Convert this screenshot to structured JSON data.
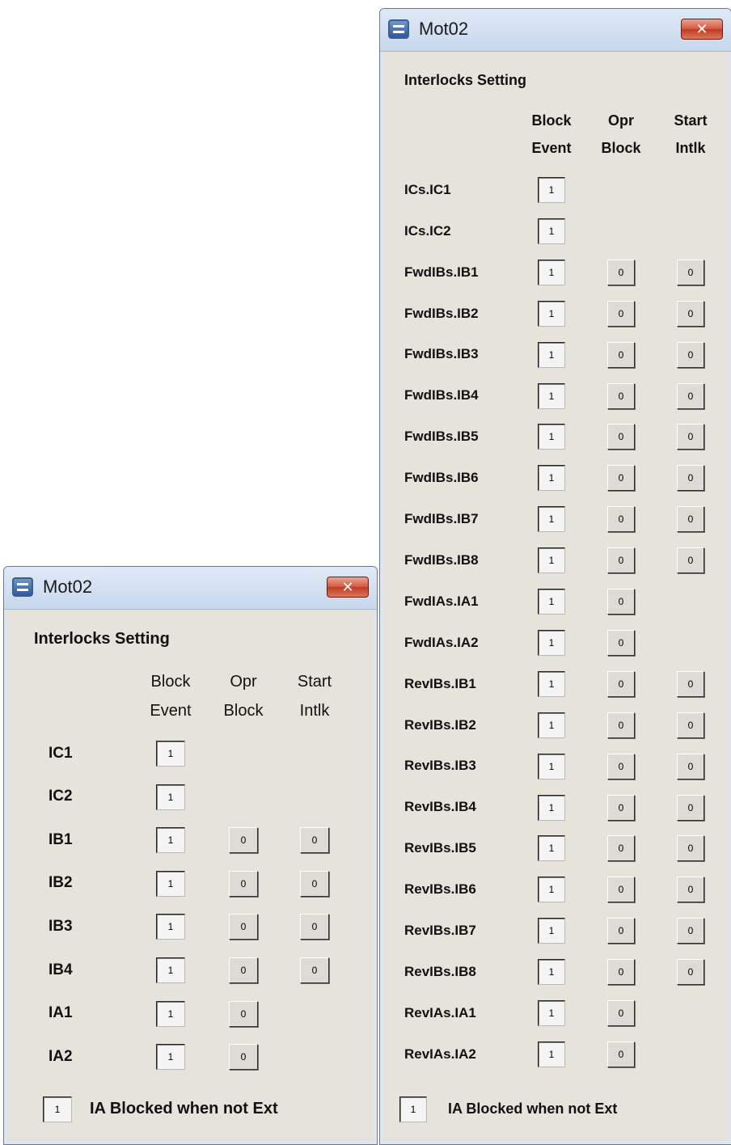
{
  "window_small": {
    "title": "Mot02",
    "close_label": "✕",
    "heading": "Interlocks Setting",
    "col_headers": {
      "block_event": [
        "Block",
        "Event"
      ],
      "opr_block": [
        "Opr",
        "Block"
      ],
      "start_intlk": [
        "Start",
        "Intlk"
      ]
    },
    "rows": [
      {
        "label": "IC1",
        "block_event": "1"
      },
      {
        "label": "IC2",
        "block_event": "1"
      },
      {
        "label": "IB1",
        "block_event": "1",
        "opr_block": "0",
        "start_intlk": "0"
      },
      {
        "label": "IB2",
        "block_event": "1",
        "opr_block": "0",
        "start_intlk": "0"
      },
      {
        "label": "IB3",
        "block_event": "1",
        "opr_block": "0",
        "start_intlk": "0"
      },
      {
        "label": "IB4",
        "block_event": "1",
        "opr_block": "0",
        "start_intlk": "0"
      },
      {
        "label": "IA1",
        "block_event": "1",
        "opr_block": "0"
      },
      {
        "label": "IA2",
        "block_event": "1",
        "opr_block": "0"
      }
    ],
    "footer": {
      "value": "1",
      "label": "IA Blocked when not Ext"
    }
  },
  "window_large": {
    "title": "Mot02",
    "close_label": "✕",
    "heading": "Interlocks Setting",
    "col_headers": {
      "block_event": [
        "Block",
        "Event"
      ],
      "opr_block": [
        "Opr",
        "Block"
      ],
      "start_intlk": [
        "Start",
        "Intlk"
      ]
    },
    "rows": [
      {
        "label": "ICs.IC1",
        "block_event": "1"
      },
      {
        "label": "ICs.IC2",
        "block_event": "1"
      },
      {
        "label": "FwdIBs.IB1",
        "block_event": "1",
        "opr_block": "0",
        "start_intlk": "0"
      },
      {
        "label": "FwdIBs.IB2",
        "block_event": "1",
        "opr_block": "0",
        "start_intlk": "0"
      },
      {
        "label": "FwdIBs.IB3",
        "block_event": "1",
        "opr_block": "0",
        "start_intlk": "0"
      },
      {
        "label": "FwdIBs.IB4",
        "block_event": "1",
        "opr_block": "0",
        "start_intlk": "0"
      },
      {
        "label": "FwdIBs.IB5",
        "block_event": "1",
        "opr_block": "0",
        "start_intlk": "0"
      },
      {
        "label": "FwdIBs.IB6",
        "block_event": "1",
        "opr_block": "0",
        "start_intlk": "0"
      },
      {
        "label": "FwdIBs.IB7",
        "block_event": "1",
        "opr_block": "0",
        "start_intlk": "0"
      },
      {
        "label": "FwdIBs.IB8",
        "block_event": "1",
        "opr_block": "0",
        "start_intlk": "0"
      },
      {
        "label": "FwdIAs.IA1",
        "block_event": "1",
        "opr_block": "0"
      },
      {
        "label": "FwdIAs.IA2",
        "block_event": "1",
        "opr_block": "0"
      },
      {
        "label": "RevIBs.IB1",
        "block_event": "1",
        "opr_block": "0",
        "start_intlk": "0"
      },
      {
        "label": "RevIBs.IB2",
        "block_event": "1",
        "opr_block": "0",
        "start_intlk": "0"
      },
      {
        "label": "RevIBs.IB3",
        "block_event": "1",
        "opr_block": "0",
        "start_intlk": "0"
      },
      {
        "label": "RevIBs.IB4",
        "block_event": "1",
        "opr_block": "0",
        "start_intlk": "0"
      },
      {
        "label": "RevIBs.IB5",
        "block_event": "1",
        "opr_block": "0",
        "start_intlk": "0"
      },
      {
        "label": "RevIBs.IB6",
        "block_event": "1",
        "opr_block": "0",
        "start_intlk": "0"
      },
      {
        "label": "RevIBs.IB7",
        "block_event": "1",
        "opr_block": "0",
        "start_intlk": "0"
      },
      {
        "label": "RevIBs.IB8",
        "block_event": "1",
        "opr_block": "0",
        "start_intlk": "0"
      },
      {
        "label": "RevIAs.IA1",
        "block_event": "1",
        "opr_block": "0"
      },
      {
        "label": "RevIAs.IA2",
        "block_event": "1",
        "opr_block": "0"
      }
    ],
    "footer": {
      "value": "1",
      "label": "IA Blocked when not Ext"
    }
  }
}
